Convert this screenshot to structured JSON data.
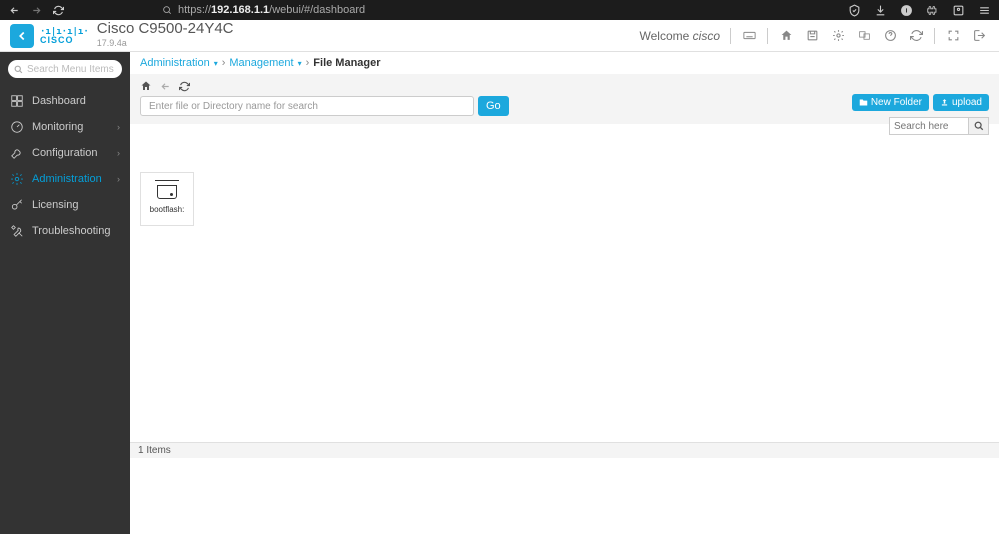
{
  "browser": {
    "url_prefix": "https://",
    "url_host": "192.168.1.1",
    "url_path": "/webui/#/dashboard"
  },
  "header": {
    "title": "Cisco C9500-24Y4C",
    "version": "17.9.4a",
    "welcome": "Welcome",
    "user": "cisco"
  },
  "sidebar": {
    "search_placeholder": "Search Menu Items",
    "items": [
      {
        "label": "Dashboard",
        "icon": "dashboard"
      },
      {
        "label": "Monitoring",
        "icon": "gauge",
        "chev": true
      },
      {
        "label": "Configuration",
        "icon": "wrench",
        "chev": true
      },
      {
        "label": "Administration",
        "icon": "gear",
        "chev": true,
        "active": true
      },
      {
        "label": "Licensing",
        "icon": "key"
      },
      {
        "label": "Troubleshooting",
        "icon": "tools"
      }
    ]
  },
  "breadcrumb": {
    "a": "Administration",
    "b": "Management",
    "c": "File Manager"
  },
  "toolbar": {
    "search_placeholder": "Enter file or Directory name for search",
    "go": "Go",
    "new_folder": "New Folder",
    "upload": "upload",
    "grid_search_placeholder": "Search here"
  },
  "files": {
    "items": [
      {
        "label": "bootflash:"
      }
    ],
    "status": "1 Items"
  }
}
